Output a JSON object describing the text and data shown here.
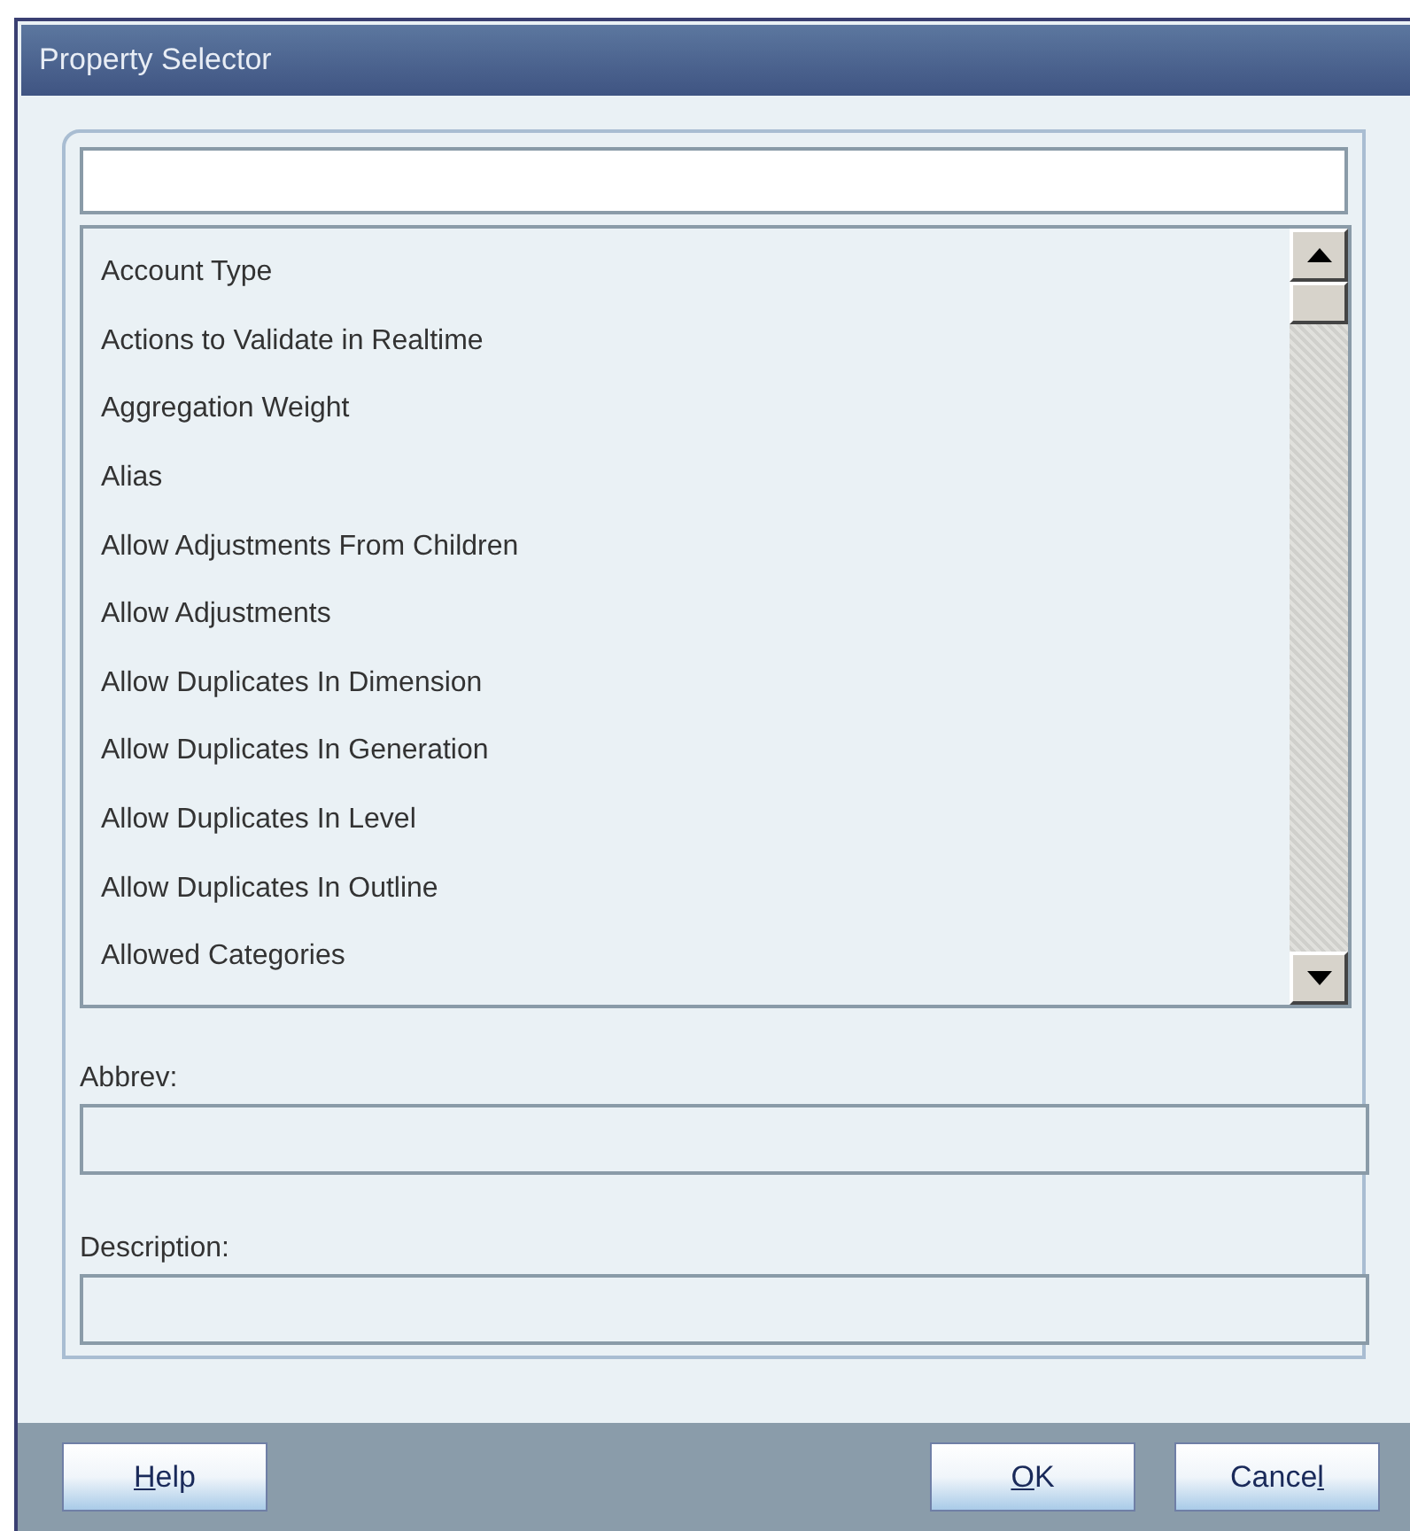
{
  "window": {
    "title": "Property Selector"
  },
  "properties": [
    "Account Type",
    "Actions to Validate in Realtime",
    "Aggregation Weight",
    "Alias",
    "Allow Adjustments From Children",
    "Allow Adjustments",
    "Allow Duplicates In Dimension",
    "Allow Duplicates In Generation",
    "Allow Duplicates In Level",
    "Allow Duplicates In Outline",
    "Allowed Categories"
  ],
  "fields": [
    {
      "label": "Abbrev:"
    },
    {
      "label": "Description:"
    }
  ],
  "left_buttons": [
    {
      "key": "H",
      "after": "elp"
    }
  ],
  "right_buttons": [
    {
      "key": "O",
      "after": "K"
    },
    {
      "before": "Cance",
      "key": "l"
    }
  ]
}
